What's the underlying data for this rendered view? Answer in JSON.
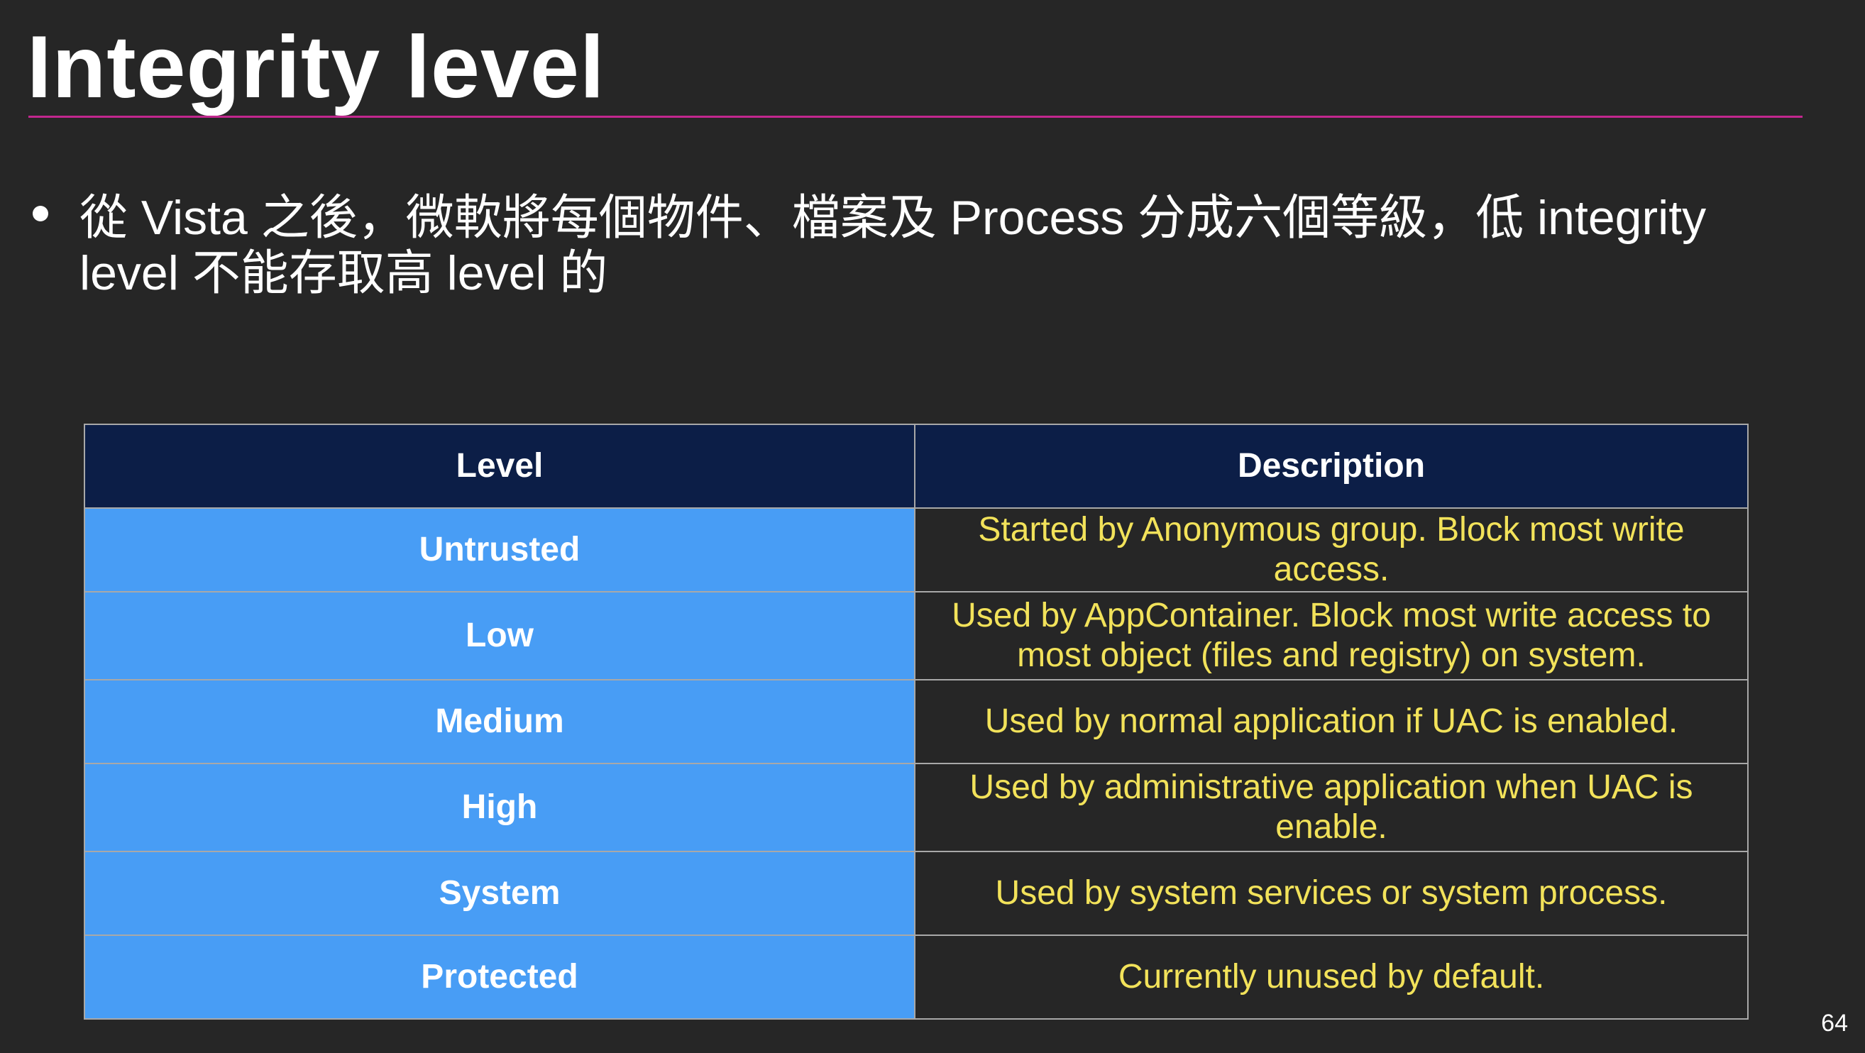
{
  "slide": {
    "title": "Integrity level",
    "bullet": "從 Vista 之後，微軟將每個物件、檔案及 Process 分成六個等級，低 integrity level 不能存取高 level 的",
    "page_number": "64"
  },
  "table": {
    "headers": [
      "Level",
      "Description"
    ],
    "rows": [
      {
        "level": "Untrusted",
        "description": "Started by Anonymous group. Block most write access."
      },
      {
        "level": "Low",
        "description": "Used by AppContainer. Block most write access to most object (files and registry) on system."
      },
      {
        "level": "Medium",
        "description": "Used by normal application if UAC is enabled."
      },
      {
        "level": "High",
        "description": "Used by administrative application when UAC is enable."
      },
      {
        "level": "System",
        "description": "Used by system services or system process."
      },
      {
        "level": "Protected",
        "description": "Currently unused by default."
      }
    ]
  },
  "colors": {
    "background": "#262626",
    "title_rule": "#c2278e",
    "header_fill": "#0c1e47",
    "level_fill": "#489df5",
    "description_text": "#f2e25a"
  }
}
